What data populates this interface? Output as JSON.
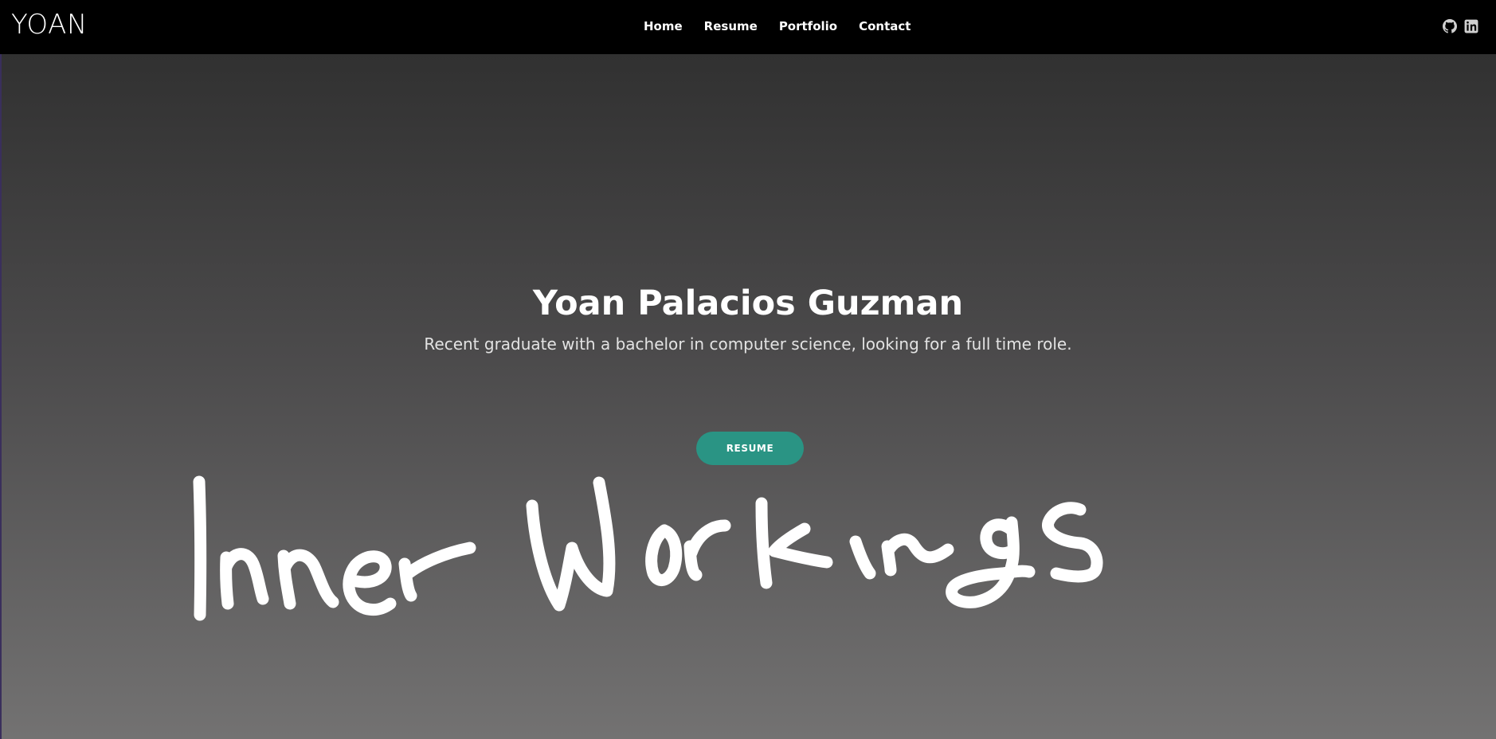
{
  "header": {
    "brand": "YOAN",
    "nav": [
      {
        "label": "Home"
      },
      {
        "label": "Resume"
      },
      {
        "label": "Portfolio"
      },
      {
        "label": "Contact"
      }
    ],
    "social": [
      {
        "icon": "github-icon"
      },
      {
        "icon": "linkedin-icon"
      }
    ]
  },
  "hero": {
    "title": "Yoan Palacios Guzman",
    "subtitle": "Recent graduate with a bachelor in computer science, looking for a full time role.",
    "button_label": "RESUME"
  },
  "overlay": {
    "handwriting": "Inner Workings"
  },
  "colors": {
    "nav_bg": "#000000",
    "button_bg": "#2a9484",
    "gradient_top": "#313131",
    "gradient_bottom": "#737272",
    "text": "#ffffff"
  }
}
